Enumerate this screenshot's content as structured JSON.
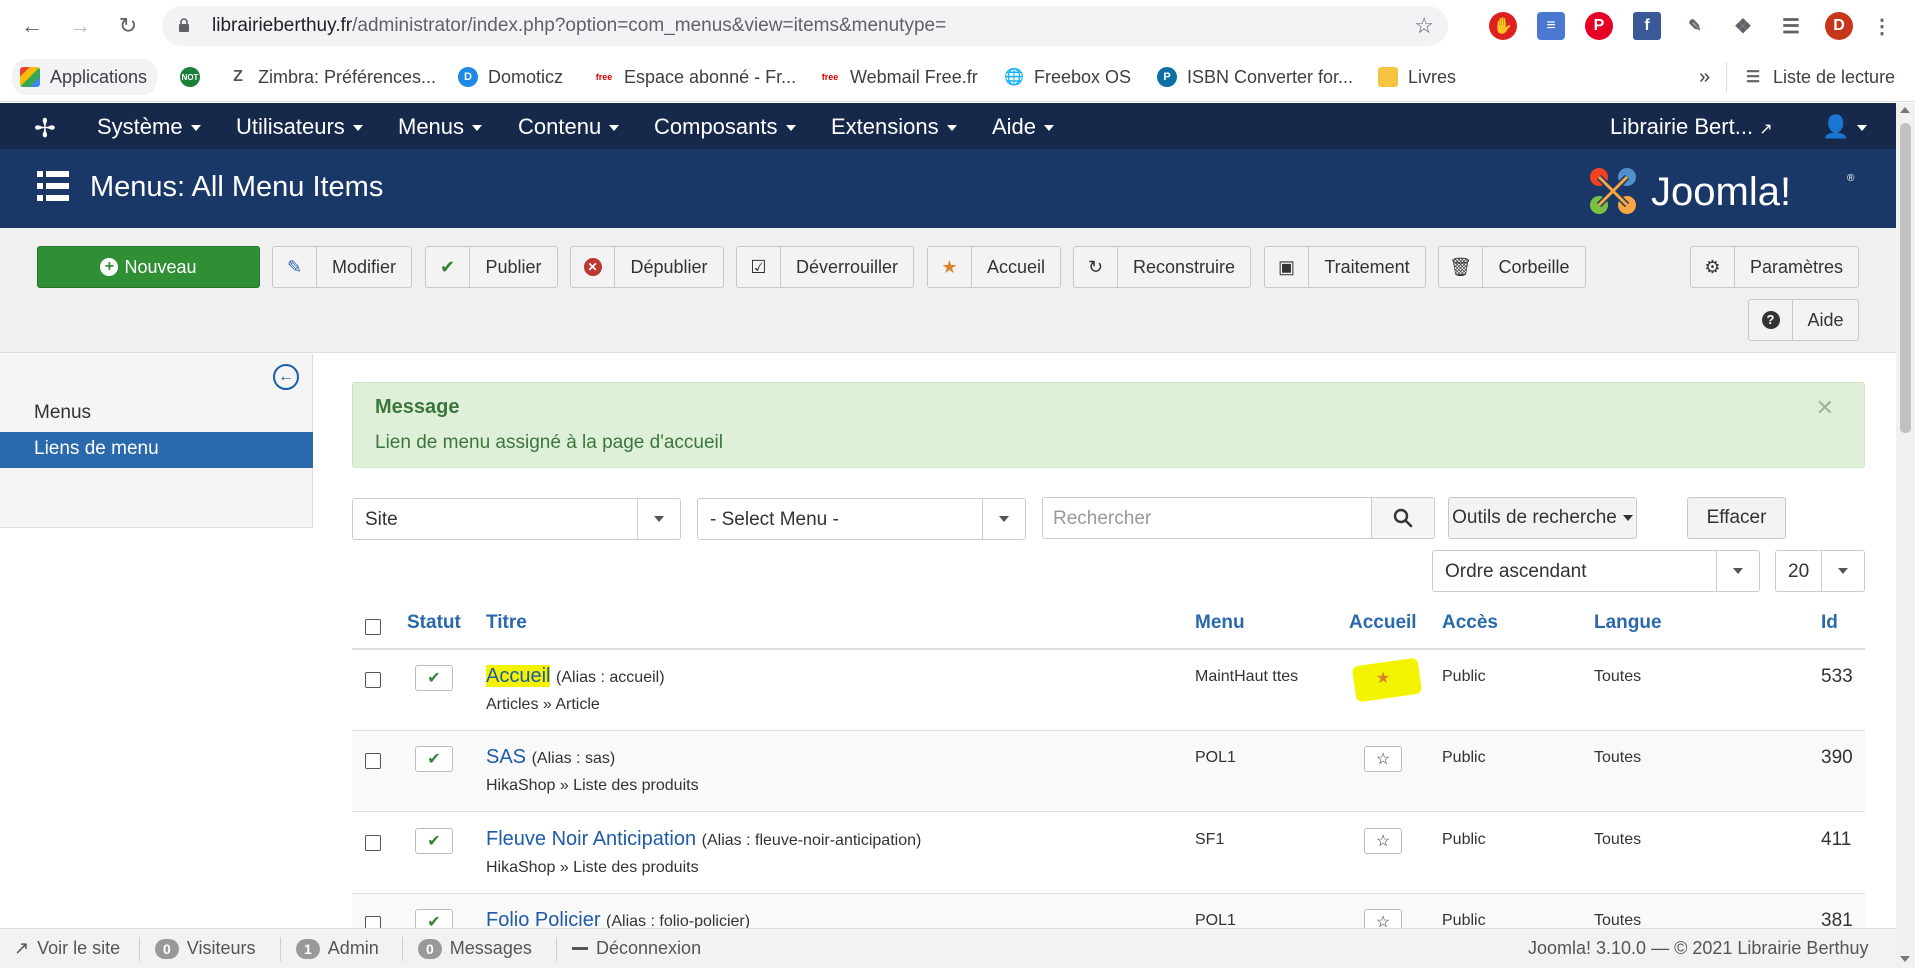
{
  "browser": {
    "url_host": "librairieberthuy.fr",
    "url_path": "/administrator/index.php?option=com_menus&view=items&menutype=",
    "profile_letter": "D",
    "bookmarks": [
      {
        "label": "Applications"
      },
      {
        "label": "Zimbra: Préférences..."
      },
      {
        "label": "Domoticz"
      },
      {
        "label": "Espace abonné - Fr..."
      },
      {
        "label": "Webmail Free.fr"
      },
      {
        "label": "Freebox OS"
      },
      {
        "label": "ISBN Converter for..."
      },
      {
        "label": "Livres"
      }
    ],
    "more": "»",
    "reading_list": "Liste de lecture"
  },
  "adminnav": {
    "menus": [
      "Système",
      "Utilisateurs",
      "Menus",
      "Contenu",
      "Composants",
      "Extensions",
      "Aide"
    ],
    "site_name": "Librairie Bert..."
  },
  "header": {
    "title": "Menus: All Menu Items"
  },
  "toolbar": {
    "new": "Nouveau",
    "edit": "Modifier",
    "publish": "Publier",
    "unpublish": "Dépublier",
    "checkin": "Déverrouiller",
    "home": "Accueil",
    "rebuild": "Reconstruire",
    "batch": "Traitement",
    "trash": "Corbeille",
    "options": "Paramètres",
    "help": "Aide"
  },
  "sidebar": {
    "items": [
      "Menus",
      "Liens de menu"
    ]
  },
  "message": {
    "heading": "Message",
    "text": "Lien de menu assigné à la page d'accueil"
  },
  "filters": {
    "client": "Site",
    "menu": "- Select Menu -",
    "search_placeholder": "Rechercher",
    "tools": "Outils de recherche",
    "clear": "Effacer",
    "ordering": "Ordre ascendant",
    "limit": "20"
  },
  "table": {
    "headers": {
      "status": "Statut",
      "title": "Titre",
      "menu": "Menu",
      "home": "Accueil",
      "access": "Accès",
      "language": "Langue",
      "id": "Id"
    },
    "rows": [
      {
        "title": "Accueil",
        "alias": "(Alias : accueil)",
        "type": "Articles » Article",
        "menu": "MaintHaut ttes",
        "access": "Public",
        "language": "Toutes",
        "id": "533"
      },
      {
        "title": "SAS",
        "alias": "(Alias : sas)",
        "type": "HikaShop » Liste des produits",
        "menu": "POL1",
        "access": "Public",
        "language": "Toutes",
        "id": "390"
      },
      {
        "title": "Fleuve Noir Anticipation",
        "alias": "(Alias : fleuve-noir-anticipation)",
        "type": "HikaShop » Liste des produits",
        "menu": "SF1",
        "access": "Public",
        "language": "Toutes",
        "id": "411"
      },
      {
        "title": "Folio Policier",
        "alias": "(Alias : folio-policier)",
        "type": "",
        "menu": "POL1",
        "access": "Public",
        "language": "Toutes",
        "id": "381"
      }
    ]
  },
  "statusbar": {
    "view_site": "Voir le site",
    "visitors_count": "0",
    "visitors": "Visiteurs",
    "admin_count": "1",
    "admin": "Admin",
    "messages_count": "0",
    "messages": "Messages",
    "logout": "Déconnexion",
    "version": "Joomla! 3.10.0",
    "copyright": "— © 2021 Librairie Berthuy"
  },
  "colors": {
    "nav": "#17294b",
    "header": "#1a3867",
    "link": "#1f5ba6",
    "success": "#dff0d8",
    "highlight": "#f3f300"
  }
}
